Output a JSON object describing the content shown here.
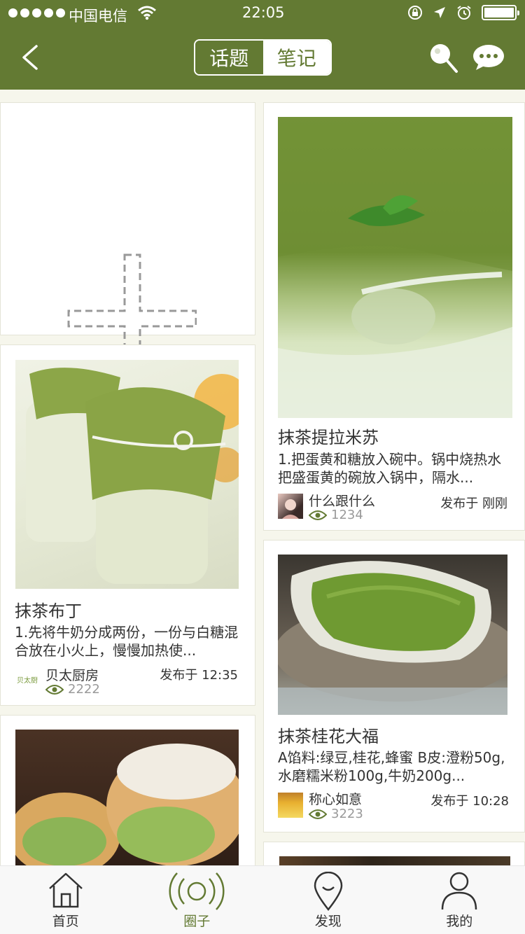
{
  "status_bar": {
    "carrier": "中国电信",
    "time": "22:05"
  },
  "nav": {
    "segments": [
      {
        "label": "话题",
        "active": true
      },
      {
        "label": "笔记",
        "active": false
      }
    ],
    "accent_color": "#637a33"
  },
  "cards": {
    "tiramisu": {
      "title": "抹茶提拉米苏",
      "desc": "1.把蛋黄和糖放入碗中。锅中烧热水把盛蛋黄的碗放入锅中，隔水...",
      "author": "什么跟什么",
      "views": "1234",
      "time": "发布于 刚刚"
    },
    "pudding": {
      "title": "抹茶布丁",
      "desc": "1.先将牛奶分成两份，一份与白糖混合放在小火上，慢慢加热使...",
      "author": "贝太厨房",
      "views": "2222",
      "time": "发布于 12:35",
      "avatar_text": "贝太厨"
    },
    "daifuku": {
      "title": "抹茶桂花大福",
      "desc": "A馅料:绿豆,桂花,蜂蜜 B皮:澄粉50g,水磨糯米粉100g,牛奶200g...",
      "author": "称心如意",
      "views": "3223",
      "time": "发布于 10:28"
    }
  },
  "tabbar": {
    "home": "首页",
    "circle": "圈子",
    "discover": "发现",
    "mine": "我的",
    "active": "circle"
  }
}
